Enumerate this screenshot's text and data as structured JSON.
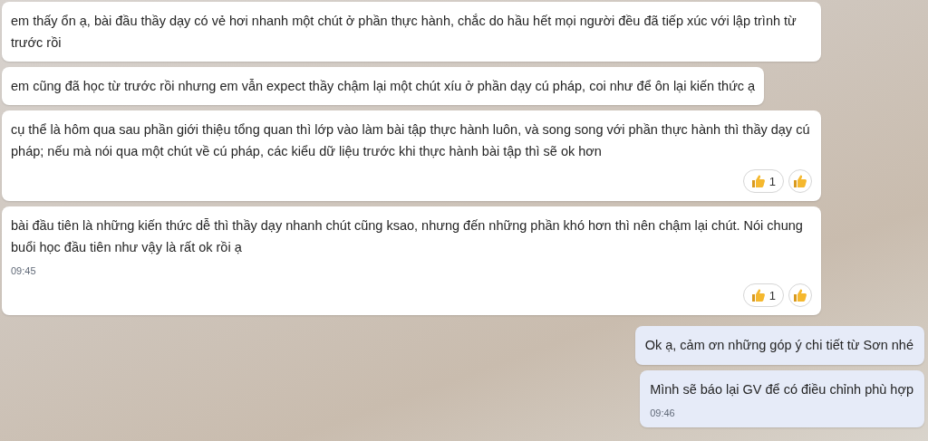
{
  "messages": [
    {
      "kind": "incoming",
      "text": "em thấy ổn ạ, bài đầu thầy dạy có vẻ hơi nhanh một chút ở phần thực hành, chắc do hầu hết mọi người đều đã tiếp xúc với lập trình từ trước rồi"
    },
    {
      "kind": "incoming",
      "text": "em cũng đã học từ trước rồi nhưng em vẫn expect thầy chậm lại một chút xíu ở phần dạy cú pháp, coi như để ôn lại kiến thức ạ"
    },
    {
      "kind": "incoming",
      "text": "cụ thể là hôm qua sau phần giới thiệu tổng quan thì lớp vào làm bài tập thực hành luôn, và song song với phần thực hành thì thầy dạy cú pháp; nếu mà nói qua một chút về cú pháp, các kiểu dữ liệu trước khi thực hành bài tập thì sẽ ok hơn",
      "reactions": [
        {
          "count": "1"
        }
      ]
    },
    {
      "kind": "incoming",
      "text": "bài đầu tiên là những kiến thức dễ thì thầy dạy nhanh chút cũng ksao, nhưng đến những phần khó hơn thì nên chậm lại chút. Nói chung buổi học đầu tiên như vậy là rất ok rồi ạ",
      "time": "09:45",
      "reactions": [
        {
          "count": "1"
        }
      ]
    },
    {
      "kind": "outgoing",
      "text": "Ok ạ, cảm ơn những góp ý chi tiết từ Sơn nhé"
    },
    {
      "kind": "outgoing",
      "text": "Mình sẽ báo lại GV để có điều chỉnh phù hợp",
      "time": "09:46"
    }
  ]
}
